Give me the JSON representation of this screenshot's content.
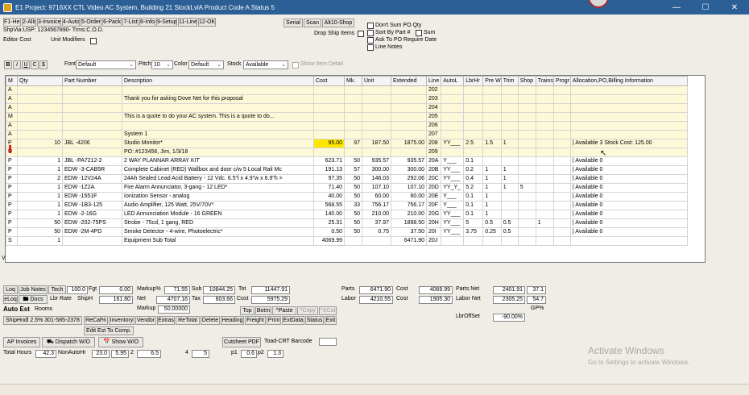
{
  "window": {
    "title": "E1 Project: 9716XX CTL Video AC System, Building 21 StockLvlA Product Code A Status 5"
  },
  "fkeys": [
    "F1-Help",
    "2-Allo",
    "3-Invoice",
    "4-Auto",
    "5-Order",
    "6-Pack",
    "7-List",
    "8-Info",
    "9-Setup",
    "11-Line",
    "12-OK"
  ],
  "header": {
    "shipvia": "ShpVia:USP: 1234567890- Trms:C.O.D.",
    "editor_cost": "Editor Cost",
    "unit_modifiers": "Unit Modifiers",
    "serial": "Serial",
    "scan": "Scan",
    "alt10": "Alt10-Shop",
    "drop_ship": "Drop Ship Items",
    "opt_dont_sum": "Don't Sum PO Qty",
    "opt_sort": "Sort By Part #",
    "opt_sum": "Sum",
    "opt_ask": "Ask To PO Require Date",
    "opt_line_notes": "Line Notes"
  },
  "format": {
    "bold": "B",
    "italic": "I",
    "underline": "U",
    "c": "C",
    "dollar": "$",
    "font_label": "Font",
    "font_value": "Default",
    "pitch_label": "Pitch",
    "pitch_value": "10",
    "color_label": "Color",
    "color_value": "Default",
    "stock_label": "Stock",
    "stock_value": "Available",
    "show_item_detail": "Show Item Detail"
  },
  "grid": {
    "columns": [
      "M",
      "Qty",
      "Part Number",
      "Description",
      "Cost",
      "Mk.",
      "Unit",
      "Extended",
      "Line",
      "AutoL",
      "LbrHr",
      "Pre W",
      "Trim",
      "Shop",
      "Trains",
      "Progr",
      "Allocation,PO,Billing Information"
    ],
    "rows": [
      {
        "m": "A",
        "qty": "",
        "part": "",
        "desc": "",
        "cost": "",
        "mk": "",
        "unit": "",
        "ext": "",
        "line": "202",
        "autol": "",
        "lbr": "",
        "pre": "",
        "trim": "",
        "shop": "",
        "trains": "",
        "progr": "",
        "alloc": "",
        "style": "yel"
      },
      {
        "m": "A",
        "qty": "",
        "part": "",
        "desc": "Thank you for asking Dove Net for this proposal",
        "cost": "",
        "mk": "",
        "unit": "",
        "ext": "",
        "line": "203",
        "autol": "",
        "lbr": "",
        "pre": "",
        "trim": "",
        "shop": "",
        "trains": "",
        "progr": "",
        "alloc": "",
        "style": "yel"
      },
      {
        "m": "A",
        "qty": "",
        "part": "",
        "desc": "",
        "cost": "",
        "mk": "",
        "unit": "",
        "ext": "",
        "line": "204",
        "autol": "",
        "lbr": "",
        "pre": "",
        "trim": "",
        "shop": "",
        "trains": "",
        "progr": "",
        "alloc": "",
        "style": "yel"
      },
      {
        "m": "M",
        "qty": "",
        "part": "",
        "desc": "This is a quote to  do your AC system. This is a quote to  do...",
        "cost": "",
        "mk": "",
        "unit": "",
        "ext": "",
        "line": "205",
        "autol": "",
        "lbr": "",
        "pre": "",
        "trim": "",
        "shop": "",
        "trains": "",
        "progr": "",
        "alloc": "",
        "style": "yel"
      },
      {
        "m": "A",
        "qty": "",
        "part": "",
        "desc": "",
        "cost": "",
        "mk": "",
        "unit": "",
        "ext": "",
        "line": "206",
        "autol": "",
        "lbr": "",
        "pre": "",
        "trim": "",
        "shop": "",
        "trains": "",
        "progr": "",
        "alloc": "",
        "style": "yel"
      },
      {
        "m": "A",
        "qty": "",
        "part": "",
        "desc": "System 1",
        "cost": "",
        "mk": "",
        "unit": "",
        "ext": "",
        "line": "207",
        "autol": "",
        "lbr": "",
        "pre": "",
        "trim": "",
        "shop": "",
        "trains": "",
        "progr": "",
        "alloc": "",
        "style": "yel"
      },
      {
        "m": "P",
        "qty": "10",
        "part": "JBL -4206",
        "desc": "Studio Monitor*",
        "cost": "95.00",
        "mk": "97",
        "unit": "187.50",
        "ext": "1875.00",
        "line": "208",
        "autol": "YY___",
        "lbr": "2.5",
        "pre": "1.5",
        "trim": "1",
        "shop": "",
        "trains": "",
        "progr": "",
        "alloc": "| Available 3 Stock Cost: 125.00",
        "style": "sel"
      },
      {
        "m": "U",
        "qty": "",
        "part": "",
        "desc": "PO: #123456, Jim, 1/3/18",
        "cost": "",
        "mk": "",
        "unit": "",
        "ext": "",
        "line": "209",
        "autol": "",
        "lbr": "",
        "pre": "",
        "trim": "",
        "shop": "",
        "trains": "",
        "progr": "",
        "alloc": "",
        "style": "yel"
      },
      {
        "m": "P",
        "qty": "1",
        "part": "JBL -PA7212-2",
        "desc": "2 WAY PLANNAR ARRAY KIT",
        "cost": "623.71",
        "mk": "50",
        "unit": "935.57",
        "ext": "935.57",
        "line": "20A",
        "autol": "Y___",
        "lbr": "0.1",
        "pre": "",
        "trim": "",
        "shop": "",
        "trains": "",
        "progr": "",
        "alloc": "| Available 0",
        "style": ""
      },
      {
        "m": "P",
        "qty": "1",
        "part": "EDW -3-CAB5R",
        "desc": "Complete Cabinet (RED)  Wallbox and door c/w 5 Local Rail Mc",
        "cost": "191.13",
        "mk": "57",
        "unit": "300.00",
        "ext": "300.00",
        "line": "20B",
        "autol": "YY___",
        "lbr": "0.2",
        "pre": "1",
        "trim": "1",
        "shop": "",
        "trains": "",
        "progr": "",
        "alloc": "| Available 0",
        "style": ""
      },
      {
        "m": "P",
        "qty": "2",
        "part": "EDW -12V24A",
        "desc": "24Ah Sealed Lead Acid Battery - 12 Vdc.  6.5\"l x 4.9\"w x 6.9\"h >",
        "cost": "97.35",
        "mk": "50",
        "unit": "146.03",
        "ext": "292.06",
        "line": "20C",
        "autol": "YY___",
        "lbr": "0.4",
        "pre": "1",
        "trim": "1",
        "shop": "",
        "trains": "",
        "progr": "",
        "alloc": "| Available 0",
        "style": ""
      },
      {
        "m": "P",
        "qty": "1",
        "part": "EDW -1Z2A",
        "desc": "Fire Alarm Annunciator, 3-gang - 12 LED*",
        "cost": "71.40",
        "mk": "50",
        "unit": "107.10",
        "ext": "107.10",
        "line": "20D",
        "autol": "YY_Y_",
        "lbr": "5.2",
        "pre": "1",
        "trim": "1",
        "shop": "5",
        "trains": "",
        "progr": "",
        "alloc": "| Available 0",
        "style": ""
      },
      {
        "m": "P",
        "qty": "1",
        "part": "EDW -1551F",
        "desc": "Ionization Sensor - analog",
        "cost": "40.00",
        "mk": "50",
        "unit": "60.00",
        "ext": "60.00",
        "line": "20E",
        "autol": "Y___",
        "lbr": "0.1",
        "pre": "1",
        "trim": "",
        "shop": "",
        "trains": "",
        "progr": "",
        "alloc": "| Available 0",
        "style": ""
      },
      {
        "m": "P",
        "qty": "1",
        "part": "EDW -1B3-125",
        "desc": "Audio Amplifier, 125 Watt, 25V/70V*",
        "cost": "568.55",
        "mk": "33",
        "unit": "756.17",
        "ext": "756.17",
        "line": "20F",
        "autol": "Y___",
        "lbr": "0.1",
        "pre": "1",
        "trim": "",
        "shop": "",
        "trains": "",
        "progr": "",
        "alloc": "| Available 0",
        "style": ""
      },
      {
        "m": "P",
        "qty": "1",
        "part": "EDW -2-16G",
        "desc": "LED Annunciation Module - 16 GREEN",
        "cost": "140.00",
        "mk": "50",
        "unit": "210.00",
        "ext": "210.00",
        "line": "20G",
        "autol": "YY___",
        "lbr": "0.1",
        "pre": "1",
        "trim": "",
        "shop": "",
        "trains": "",
        "progr": "",
        "alloc": "| Available 0",
        "style": ""
      },
      {
        "m": "P",
        "qty": "50",
        "part": "EDW -202-75PS",
        "desc": "Strobe - 75cd, 1 gang, RED",
        "cost": "25.31",
        "mk": "50",
        "unit": "37.97",
        "ext": "1898.50",
        "line": "20H",
        "autol": "YY___",
        "lbr": "5",
        "pre": "0.5",
        "trim": "0.5",
        "shop": "",
        "trains": "1",
        "progr": "",
        "alloc": "| Available 0",
        "style": ""
      },
      {
        "m": "P",
        "qty": "50",
        "part": "EDW -2M-4PD",
        "desc": "Smoke Detector - 4-wire, Photoelectric*",
        "cost": "0.50",
        "mk": "50",
        "unit": "0.75",
        "ext": "37.50",
        "line": "20I",
        "autol": "YY___",
        "lbr": "3.75",
        "pre": "0.25",
        "trim": "0.5",
        "shop": "",
        "trains": "",
        "progr": "",
        "alloc": "| Available 0",
        "style": ""
      },
      {
        "m": "S",
        "qty": "1",
        "part": "",
        "desc": "Equipment Sub Total",
        "cost": "4069.99",
        "mk": "",
        "unit": "",
        "ext": "6471.90",
        "line": "20J",
        "autol": "",
        "lbr": "",
        "pre": "",
        "trim": "",
        "shop": "",
        "trains": "",
        "progr": "",
        "alloc": "",
        "style": ""
      }
    ]
  },
  "totals": {
    "loq": "Loq",
    "job_notes": "Job Notes",
    "tech": "Tech",
    "tech_val": "100.0",
    "fgt": "Fgt",
    "fgt_val": "0.00",
    "markup_pct": "Markup%",
    "markup_pct_val": "71.55",
    "sub": "Sub",
    "sub_val": "10844.25",
    "tot": "Tot",
    "tot_val": "11447.91",
    "eloq": "eLoq",
    "docs": "Docs",
    "lbr_rate": "Lbr Rate",
    "shiph": "ShipH",
    "shiph_val": "161.80",
    "net": "Net",
    "net_val": "4707.16",
    "tax": "Tax",
    "tax_val": "603.66",
    "cost": "Cost",
    "cost_val": "5975.29",
    "auto_est": "Auto Est",
    "rooms": "Rooms",
    "markup": "Markup",
    "markup_val": "50.00000",
    "top": "Top",
    "botm": "Botm",
    "paste": "^Paste",
    "copy": "^Copy",
    "xcut": "^XCut",
    "parts": "Parts",
    "parts_val": "6471.90",
    "parts_cost_label": "Cost",
    "parts_cost_val": "4069.99",
    "parts_net": "Parts Net",
    "parts_net_val": "2401.91",
    "parts_net_pct": "37.1",
    "labor": "Labor",
    "labor_val": "4210.55",
    "labor_cost_label": "Cost",
    "labor_cost_val": "1905.30",
    "labor_net": "Labor Net",
    "labor_net_val": "2305.25",
    "labor_net_pct": "54.7",
    "gp_pct": "GP%",
    "lbroffset": "LbrOffSet",
    "lbroffset_val": "-90.00%",
    "shiphndl": "ShipHndl 2.5% 301-585-2378",
    "recalc": "ReCal%",
    "inventory": "Inventory",
    "vendor": "Vendor",
    "extras": "Extras",
    "retotal": "ReTotal",
    "delete": "Delete",
    "heading": "Heading",
    "freight": "Freight",
    "print": "Print",
    "extdata": "ExtData",
    "status": "Status",
    "exit": "Exit",
    "edit_est": "Edit Est To Comp.",
    "ap_invoices": "AP Invoices",
    "dispatch": "Dispatch W/O",
    "show_wo": "Show W/O",
    "cutsheet": "Cutsheet PDF",
    "toad": "Toad-CRT Barcode",
    "total_hours": "Total Hours",
    "total_hours_val": "42.3",
    "nonautohr": "NonAutoHr",
    "nonautohr_val": "23.0",
    "v1": "5.95",
    "v2": "2",
    "v3": "6.5",
    "v4": "4",
    "v5": "5",
    "p1": "p1",
    "p1_val": "0.6",
    "p2": "p2",
    "p2_val": "1.3"
  },
  "watermark": {
    "line1": "Activate Windows",
    "line2": "Go to Settings to activate Windows."
  }
}
